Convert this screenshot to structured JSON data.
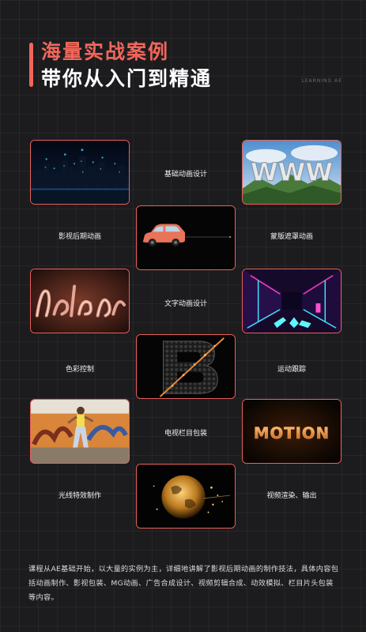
{
  "header": {
    "title_line1": "海量实战案例",
    "title_line2": "带你从入门到精通",
    "side_tag": "LEARNING AE"
  },
  "cases": [
    {
      "label": "影视后期动画",
      "image_icon": "city-night-icon"
    },
    {
      "label": "基础动画设计",
      "image_icon": "car-icon"
    },
    {
      "label": "蒙版遮罩动画",
      "image_icon": "www-landscape-icon"
    },
    {
      "label": "色彩控制",
      "image_icon": "neon-script-icon"
    },
    {
      "label": "文字动画设计",
      "image_icon": "letter-b-icon"
    },
    {
      "label": "运动跟踪",
      "image_icon": "neon-corridor-icon"
    },
    {
      "label": "光线特效制作",
      "image_icon": "dancer-graffiti-icon"
    },
    {
      "label": "电视栏目包装",
      "image_icon": "gold-globe-icon"
    },
    {
      "label": "视频渲染、输出",
      "image_icon": "motion-text-icon"
    }
  ],
  "card_texts": {
    "www": "WWW",
    "motion": "MOTION"
  },
  "description": "课程从AE基础开始，以大量的实例为主，详细地讲解了影视后期动画的制作技法，具体内容包括动画制作、影视包装、MG动画、广告合成设计、视频剪辑合成、动效模拟、栏目片头包装等内容。",
  "colors": {
    "accent": "#f0665a",
    "background": "#1c1c1e",
    "card_border": "#e8605a"
  }
}
